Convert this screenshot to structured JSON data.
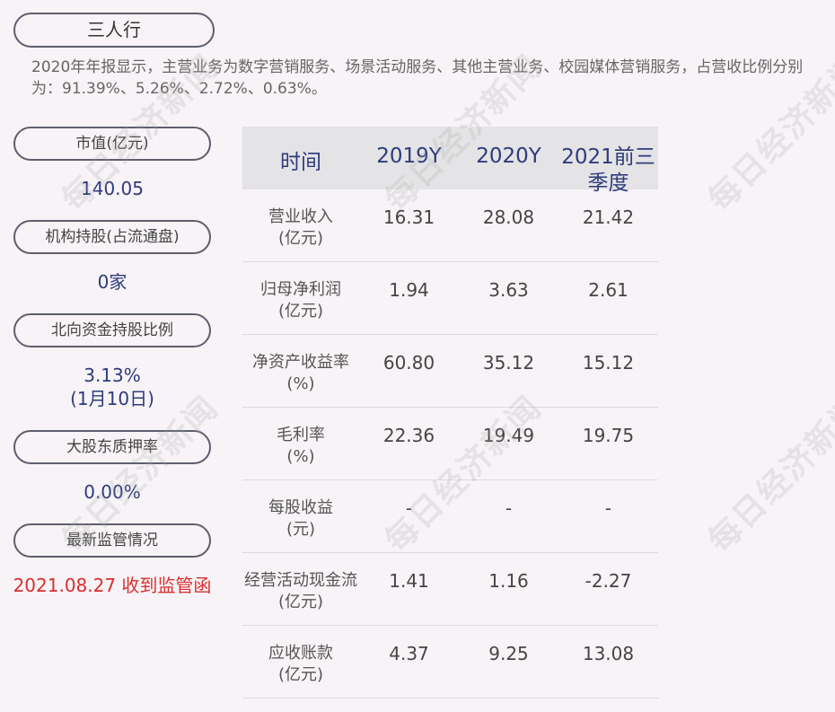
{
  "title": "三人行",
  "intro": "2020年年报显示，主营业务为数字营销服务、场景活动服务、其他主营业务、校园媒体营销服务，占营收比例分别为：91.39%、5.26%、2.72%、0.63%。",
  "stats": [
    {
      "label": "市值(亿元)",
      "value": "140.05"
    },
    {
      "label": "机构持股(占流通盘)",
      "value": "0家"
    },
    {
      "label": "北向资金持股比例",
      "value": "3.13%\n(1月10日)"
    },
    {
      "label": "大股东质押率",
      "value": "0.00%"
    },
    {
      "label": "最新监管情况",
      "value": "2021.08.27 收到监管函"
    }
  ],
  "table": {
    "headers": [
      "时间",
      "2019Y",
      "2020Y",
      "2021前三季度"
    ],
    "rows": [
      {
        "label": "营业收入\n(亿元)",
        "values": [
          "16.31",
          "28.08",
          "21.42"
        ]
      },
      {
        "label": "归母净利润\n(亿元)",
        "values": [
          "1.94",
          "3.63",
          "2.61"
        ]
      },
      {
        "label": "净资产收益率\n(%)",
        "values": [
          "60.80",
          "35.12",
          "15.12"
        ]
      },
      {
        "label": "毛利率\n(%)",
        "values": [
          "22.36",
          "19.49",
          "19.75"
        ]
      },
      {
        "label": "每股收益\n(元)",
        "values": [
          "-",
          "-",
          "-"
        ]
      },
      {
        "label": "经营活动现金流\n(亿元)",
        "values": [
          "1.41",
          "1.16",
          "-2.27"
        ]
      },
      {
        "label": "应收账款\n(亿元)",
        "values": [
          "4.37",
          "9.25",
          "13.08"
        ]
      }
    ]
  },
  "watermark": "每日经济新闻",
  "colors": {
    "accent": "#2e3b7c",
    "alert": "#d92f2f",
    "header_bg": "#e4e3e5",
    "page_bg": "#f7f3f6"
  }
}
